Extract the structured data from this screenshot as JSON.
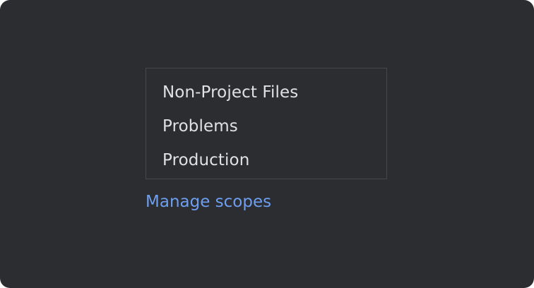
{
  "scopes": {
    "items": [
      {
        "label": "Non-Project Files"
      },
      {
        "label": "Problems"
      },
      {
        "label": "Production"
      }
    ]
  },
  "manage_link": "Manage scopes",
  "colors": {
    "background": "#2b2d30",
    "item_text": "#dfe1e5",
    "list_border": "#45474b",
    "link": "#6d9ef0"
  }
}
